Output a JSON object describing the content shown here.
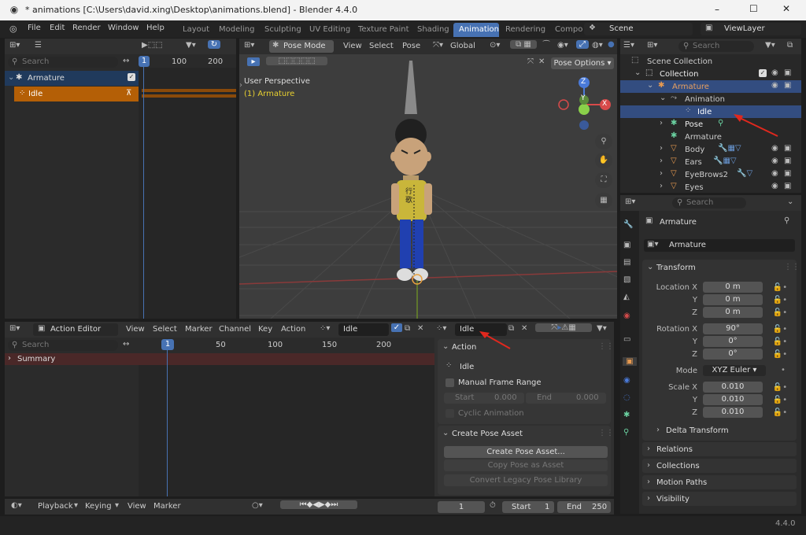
{
  "titlebar": {
    "title": "* animations [C:\\Users\\david.xing\\Desktop\\animations.blend] - Blender 4.4.0",
    "minimize": "–",
    "maximize": "☐",
    "close": "✕"
  },
  "menubar": {
    "items": [
      "File",
      "Edit",
      "Render",
      "Window",
      "Help"
    ],
    "workspaces": [
      "Layout",
      "Modeling",
      "Sculpting",
      "UV Editing",
      "Texture Paint",
      "Shading",
      "Animation",
      "Rendering",
      "Compo"
    ],
    "active_workspace": "Animation",
    "scene": "Scene",
    "view_layer": "ViewLayer"
  },
  "dopesheet": {
    "search_placeholder": "Search",
    "frame_current": "1",
    "ticks": [
      "100",
      "200"
    ],
    "tracks": [
      {
        "label": "Armature"
      },
      {
        "label": "Idle"
      }
    ]
  },
  "viewport": {
    "mode": "Pose Mode",
    "menus": [
      "View",
      "Select",
      "Pose"
    ],
    "orientation": "Global",
    "overlay_title": "User Perspective",
    "overlay_sub": "(1) Armature",
    "pose_options": "Pose Options",
    "axes": {
      "x": "X",
      "y": "Y",
      "z": "Z"
    },
    "shirt_text": "行歌"
  },
  "outliner": {
    "search_placeholder": "Search",
    "items": [
      {
        "label": "Scene Collection",
        "depth": 0
      },
      {
        "label": "Collection",
        "depth": 1
      },
      {
        "label": "Armature",
        "depth": 2
      },
      {
        "label": "Animation",
        "depth": 3
      },
      {
        "label": "Idle",
        "depth": 4
      },
      {
        "label": "Pose",
        "depth": 3
      },
      {
        "label": "Armature",
        "depth": 3
      },
      {
        "label": "Body",
        "depth": 3
      },
      {
        "label": "Ears",
        "depth": 3
      },
      {
        "label": "EyeBrows2",
        "depth": 3
      },
      {
        "label": "Eyes",
        "depth": 3
      }
    ]
  },
  "properties": {
    "search_placeholder": "Search",
    "object_name": "Armature",
    "datablock": "Armature",
    "transform": {
      "title": "Transform",
      "location_label": "Location X",
      "y_label": "Y",
      "z_label": "Z",
      "location": [
        "0 m",
        "0 m",
        "0 m"
      ],
      "rotation_label": "Rotation X",
      "rotation": [
        "90°",
        "0°",
        "0°"
      ],
      "mode_label": "Mode",
      "mode": "XYZ Euler",
      "scale_label": "Scale X",
      "scale": [
        "0.010",
        "0.010",
        "0.010"
      ],
      "delta": "Delta Transform"
    },
    "sections": [
      "Relations",
      "Collections",
      "Motion Paths",
      "Visibility"
    ]
  },
  "action_editor": {
    "editor": "Action Editor",
    "menus": [
      "View",
      "Select",
      "Marker",
      "Channel",
      "Key",
      "Action"
    ],
    "action": "Idle",
    "search_placeholder": "Search",
    "summary": "Summary",
    "frame_current": "1",
    "ticks": [
      "50",
      "100",
      "150",
      "200"
    ]
  },
  "side_panel": {
    "action_title": "Action",
    "action_name": "Idle",
    "action_field": "Idle",
    "manual_frame_range": "Manual Frame Range",
    "start_label": "Start",
    "start_value": "0.000",
    "end_label": "End",
    "end_value": "0.000",
    "cyclic": "Cyclic Animation",
    "pose_asset_title": "Create Pose Asset",
    "create_pose_asset": "Create Pose Asset...",
    "copy_pose": "Copy Pose as Asset",
    "convert_legacy": "Convert Legacy Pose Library"
  },
  "timeline": {
    "menus": [
      "Playback",
      "Keying",
      "View",
      "Marker"
    ],
    "frame_current": "1",
    "start_label": "Start",
    "start_value": "1",
    "end_label": "End",
    "end_value": "250"
  },
  "statusbar": {
    "version": "4.4.0"
  },
  "colors": {
    "accent": "#4772b3",
    "active_tab": "#4772b3",
    "orange_row": "#b45f06",
    "selected_row": "#334d80",
    "red_arrow": "#e0281e"
  }
}
